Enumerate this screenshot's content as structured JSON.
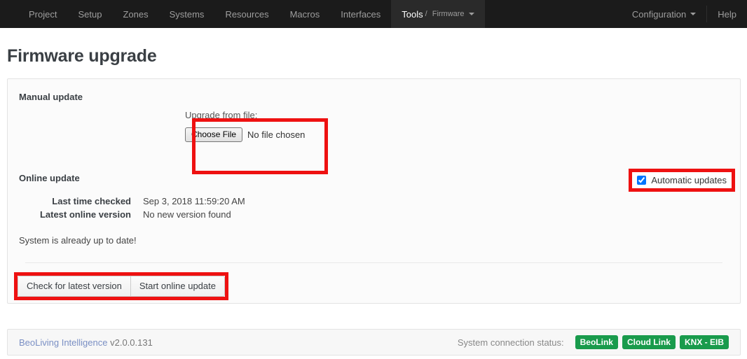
{
  "navbar": {
    "left_items": [
      {
        "label": "Project"
      },
      {
        "label": "Setup"
      },
      {
        "label": "Zones"
      },
      {
        "label": "Systems"
      },
      {
        "label": "Resources"
      },
      {
        "label": "Macros"
      },
      {
        "label": "Interfaces"
      }
    ],
    "active_item": {
      "main": "Tools",
      "separator": "/",
      "sub": "Firmware"
    },
    "right_items": [
      {
        "label": "Configuration",
        "has_caret": true
      },
      {
        "label": "Help",
        "has_caret": false
      }
    ]
  },
  "page": {
    "title": "Firmware upgrade"
  },
  "manual_update": {
    "heading": "Manual update",
    "file_label": "Upgrade from file:",
    "choose_file_button": "Choose File",
    "no_file_text": "No file chosen"
  },
  "online_update": {
    "heading": "Online update",
    "automatic_updates_label": "Automatic updates",
    "automatic_updates_checked": true,
    "details": [
      {
        "label": "Last time checked",
        "value": "Sep 3, 2018 11:59:20 AM"
      },
      {
        "label": "Latest online version",
        "value": "No new version found"
      }
    ],
    "status_text": "System is already up to date!",
    "buttons": [
      {
        "label": "Check for latest version"
      },
      {
        "label": "Start online update"
      }
    ]
  },
  "footer": {
    "product_link": "BeoLiving Intelligence",
    "version": "v2.0.0.131",
    "connection_status_label": "System connection status:",
    "badges": [
      {
        "label": "BeoLink"
      },
      {
        "label": "Cloud Link"
      },
      {
        "label": "KNX - EIB"
      }
    ]
  },
  "colors": {
    "navbar_bg": "#1b1b1b",
    "navbar_active_bg": "#2a2a2a",
    "annotation_red": "#ee1111",
    "badge_green": "#199b4c",
    "link_blue": "#7a8fc4"
  }
}
